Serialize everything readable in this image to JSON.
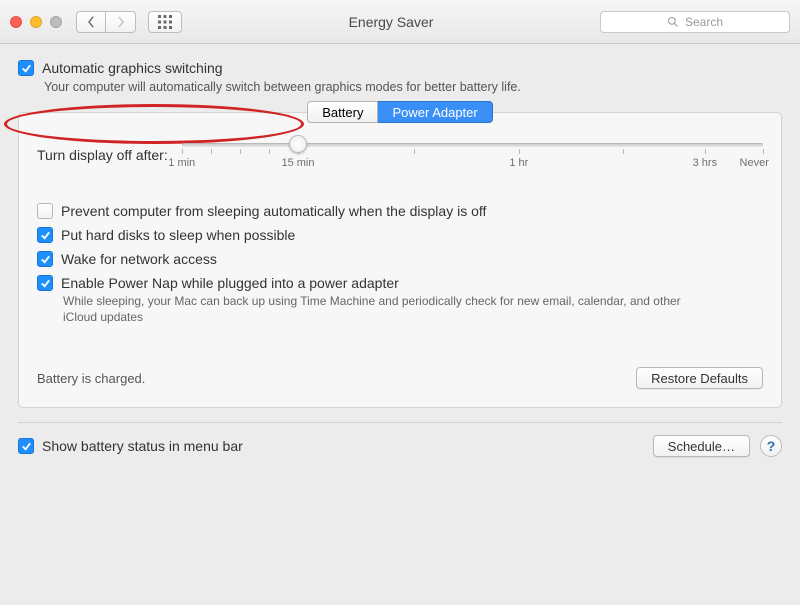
{
  "window": {
    "title": "Energy Saver",
    "search_placeholder": "Search"
  },
  "auto_graphics": {
    "checked": true,
    "label": "Automatic graphics switching",
    "sub": "Your computer will automatically switch between graphics modes for better battery life."
  },
  "tabs": {
    "battery": "Battery",
    "power_adapter": "Power Adapter",
    "active": "power_adapter"
  },
  "slider": {
    "label": "Turn display off after:",
    "ticks": [
      "1 min",
      "15 min",
      "1 hr",
      "3 hrs",
      "Never"
    ],
    "value_percent": 20
  },
  "options": {
    "prevent_sleep": {
      "checked": false,
      "label": "Prevent computer from sleeping automatically when the display is off"
    },
    "hd_sleep": {
      "checked": true,
      "label": "Put hard disks to sleep when possible"
    },
    "wake_network": {
      "checked": true,
      "label": "Wake for network access"
    },
    "power_nap": {
      "checked": true,
      "label": "Enable Power Nap while plugged into a power adapter",
      "sub": "While sleeping, your Mac can back up using Time Machine and periodically check for new email, calendar, and other iCloud updates"
    }
  },
  "battery_status_text": "Battery is charged.",
  "buttons": {
    "restore_defaults": "Restore Defaults",
    "schedule": "Schedule…"
  },
  "show_status": {
    "checked": true,
    "label": "Show battery status in menu bar"
  },
  "colors": {
    "accent": "#1f8fff",
    "annotation": "#d02323"
  }
}
